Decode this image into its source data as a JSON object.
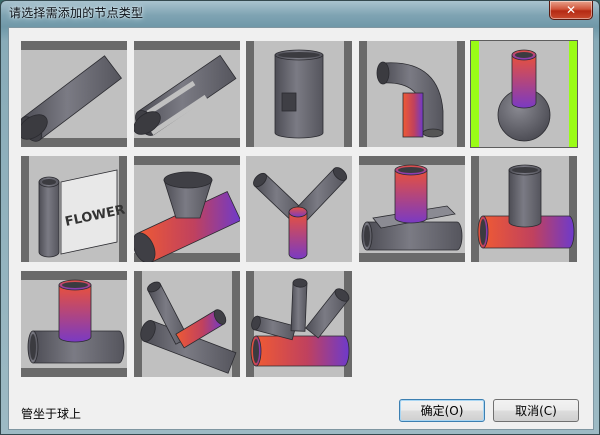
{
  "window": {
    "title": "请选择需添加的节点类型",
    "close_symbol": "✕"
  },
  "grid": {
    "items": [
      {
        "name": "node-type-beveled-pipe"
      },
      {
        "name": "node-type-slotted-pipe"
      },
      {
        "name": "node-type-pipe-with-plate"
      },
      {
        "name": "node-type-elbow"
      },
      {
        "name": "node-type-pipe-on-sphere",
        "selected": true
      },
      {
        "name": "node-type-flower-plate",
        "text": "FLOWER"
      },
      {
        "name": "node-type-cone-on-pipe"
      },
      {
        "name": "node-type-y-branch"
      },
      {
        "name": "node-type-pipe-with-saddle-plate"
      },
      {
        "name": "node-type-t-joint"
      },
      {
        "name": "node-type-t-joint-reversed"
      },
      {
        "name": "node-type-multi-branch"
      },
      {
        "name": "node-type-multi-branch-k"
      }
    ]
  },
  "status": {
    "text": "管坐于球上"
  },
  "buttons": {
    "ok": "确定(O)",
    "cancel": "取消(C)"
  },
  "colors": {
    "selected_border": "#9afc16",
    "pipe_gray": "#6f6f77",
    "pipe_red": "#e8543a",
    "pipe_purple": "#7a3fc8"
  }
}
